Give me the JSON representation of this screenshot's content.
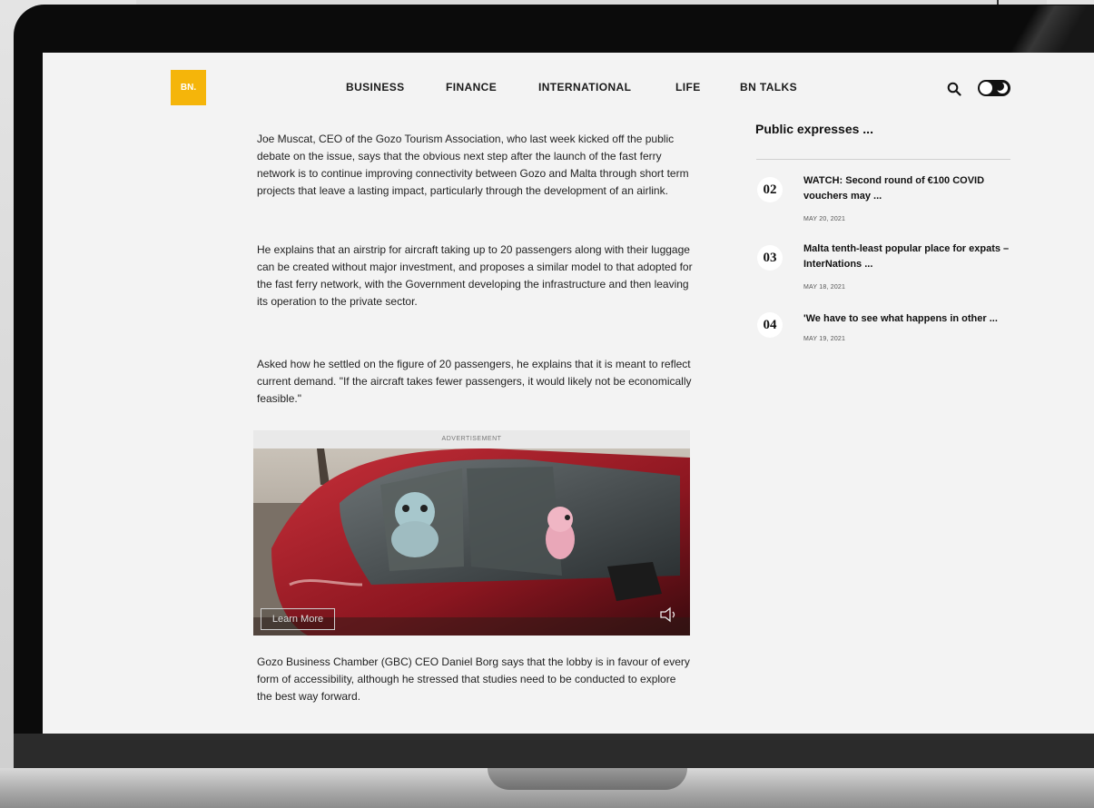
{
  "brand": {
    "logo_text": "BN.",
    "accent": "#f5b50a"
  },
  "nav": {
    "items": [
      "BUSINESS",
      "FINANCE",
      "INTERNATIONAL",
      "LIFE",
      "BN TALKS"
    ]
  },
  "article": {
    "paragraphs": [
      "Joe Muscat, CEO of the Gozo Tourism Association, who last week kicked off the public debate on the issue, says that the obvious next step after the launch of the fast ferry network is to continue improving connectivity between Gozo and Malta through short term projects that leave a lasting impact, particularly through the development of an airlink.",
      "He explains that an airstrip for aircraft taking up to 20 passengers along with their luggage can be created without major investment, and proposes a similar model to that adopted for the fast ferry network, with the Government developing the infrastructure and then leaving its operation to the private sector.",
      "Asked how he settled on the figure of 20 passengers, he explains that it is meant to reflect current demand. \"If the aircraft takes fewer passengers, it would likely not be economically feasible.\"",
      "Gozo Business Chamber (GBC) CEO Daniel Borg says that the lobby is in favour of every form of accessibility, although he stressed that studies need to be conducted to explore the best way forward."
    ]
  },
  "advertisement": {
    "label": "ADVERTISEMENT",
    "cta": "Learn More"
  },
  "sidebar": {
    "title": "Public expresses ...",
    "items": [
      {
        "rank": "02",
        "title": "WATCH: Second round of €100 COVID vouchers may ...",
        "date": "MAY 20, 2021"
      },
      {
        "rank": "03",
        "title": "Malta tenth-least popular place for expats – InterNations ...",
        "date": "MAY 18, 2021"
      },
      {
        "rank": "04",
        "title": "'We have to see what happens in other ...",
        "date": "MAY 19, 2021"
      }
    ]
  }
}
